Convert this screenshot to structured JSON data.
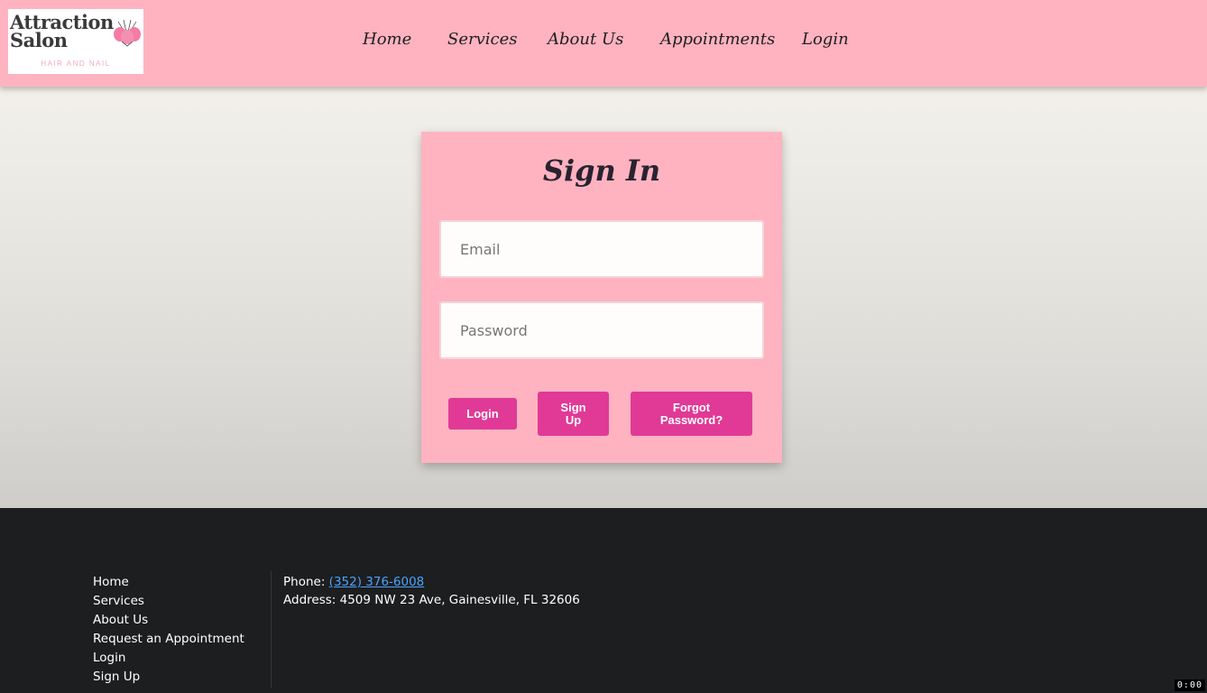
{
  "header": {
    "logo": {
      "line1": "Attraction",
      "line2": "Salon",
      "tagline": "HAIR AND NAIL"
    },
    "nav": [
      {
        "label": "Home"
      },
      {
        "label": "Services"
      },
      {
        "label": "About Us"
      },
      {
        "label": "Appointments"
      },
      {
        "label": "Login"
      }
    ]
  },
  "signin": {
    "title": "Sign In",
    "email_placeholder": "Email",
    "password_placeholder": "Password",
    "login_label": "Login",
    "signup_label": "Sign Up",
    "forgot_label": "Forgot Password?"
  },
  "footer": {
    "links": [
      {
        "label": "Home"
      },
      {
        "label": "Services"
      },
      {
        "label": "About Us"
      },
      {
        "label": "Request an Appointment"
      },
      {
        "label": "Login"
      },
      {
        "label": "Sign Up"
      }
    ],
    "phone_label": "Phone: ",
    "phone": "(352) 376-6008",
    "address_label": "Address: ",
    "address": "4509 NW 23 Ave, Gainesville, FL 32606"
  },
  "timer": "0:00",
  "colors": {
    "header_bg": "#ffb3c1",
    "button": "#e03a96",
    "footer_bg": "#1d1e20",
    "link": "#4aa3ff"
  }
}
